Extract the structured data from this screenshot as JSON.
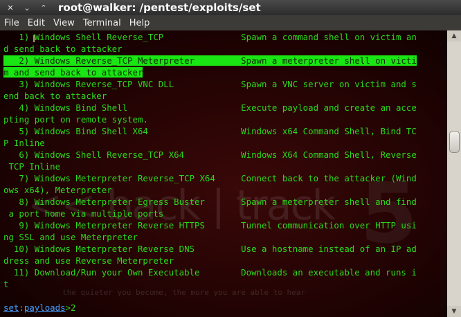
{
  "window": {
    "title": "root@walker: /pentest/exploits/set",
    "close_glyph": "✕",
    "minimize_glyph": "⌄",
    "maximize_glyph": "⌃"
  },
  "menu": [
    "File",
    "Edit",
    "View",
    "Terminal",
    "Help"
  ],
  "terminal": {
    "lines": [
      "   1) Windows Shell Reverse_TCP               Spawn a command shell on victim an",
      "d send back to attacker",
      "   2) Windows Reverse_TCP Meterpreter         Spawn a meterpreter shell on victi",
      "m and send back to attacker",
      "   3) Windows Reverse_TCP VNC DLL             Spawn a VNC server on victim and s",
      "end back to attacker",
      "   4) Windows Bind Shell                      Execute payload and create an acce",
      "pting port on remote system.",
      "   5) Windows Bind Shell X64                  Windows x64 Command Shell, Bind TC",
      "P Inline",
      "   6) Windows Shell Reverse_TCP X64           Windows X64 Command Shell, Reverse",
      " TCP Inline",
      "   7) Windows Meterpreter Reverse_TCP X64     Connect back to the attacker (Wind",
      "ows x64), Meterpreter",
      "   8) Windows Meterpreter Egress Buster       Spawn a meterpreter shell and find",
      " a port home via multiple ports",
      "   9) Windows Meterpreter Reverse HTTPS       Tunnel communication over HTTP usi",
      "ng SSL and use Meterpreter",
      "  10) Windows Meterpreter Reverse DNS         Use a hostname instead of an IP ad",
      "dress and use Reverse Meterpreter",
      "  11) Download/Run your Own Executable        Downloads an executable and runs i",
      "t"
    ],
    "highlighted_lines": [
      2,
      3
    ],
    "prompt": {
      "prefix": "set",
      "separator": ":",
      "module": "payloads",
      "symbol": ">",
      "input": "2"
    }
  },
  "background": {
    "logo_text": "<< back | track",
    "version_text": "5",
    "tagline": "the quieter you become, the more you are able to hear"
  },
  "colors": {
    "terminal_text": "#2bd81d",
    "selection": "#19e612",
    "prompt_keyword": "#45a0ff"
  },
  "icons": {
    "ibeam_cursor": "I"
  }
}
